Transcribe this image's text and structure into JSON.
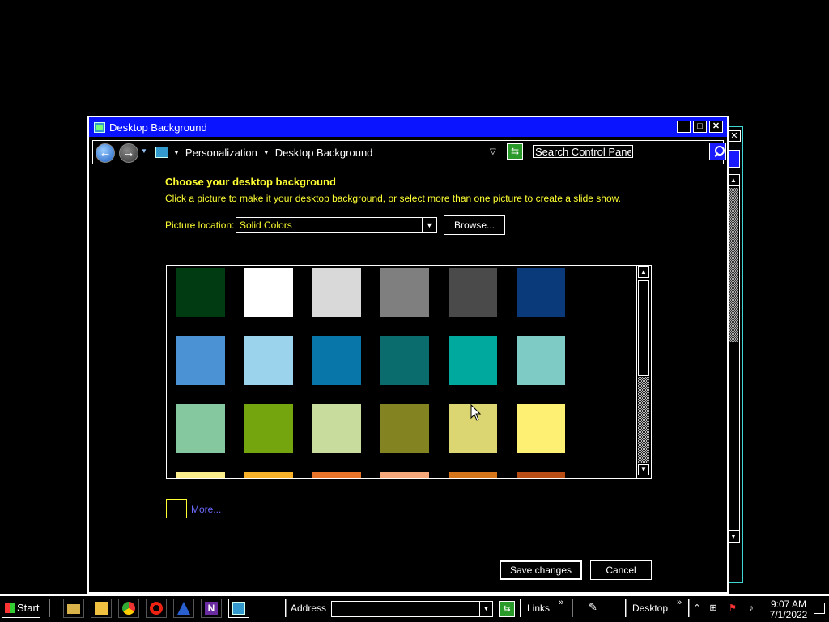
{
  "window": {
    "title": "Desktop Background",
    "buttons": [
      "_",
      "□",
      "✕"
    ]
  },
  "address_bar": {
    "crumbs": [
      "Personalization",
      "Desktop Background"
    ],
    "search_placeholder": "Search Control Panel"
  },
  "content": {
    "heading": "Choose your desktop background",
    "description": "Click a picture to make it your desktop background, or select more than one picture to create a slide show.",
    "picture_location_label": "Picture location:",
    "picture_location_value": "Solid Colors",
    "browse_label": "Browse...",
    "more_label": "More...",
    "save_label": "Save changes",
    "cancel_label": "Cancel"
  },
  "swatches": [
    [
      "#003b11",
      "#ffffff",
      "#d9d9d9",
      "#7f7f7f",
      "#4a4a4a",
      "#0b3a7b"
    ],
    [
      "#4a92d4",
      "#9cd3ec",
      "#0876a8",
      "#0b6c6e",
      "#00a99d",
      "#7ecbc6"
    ],
    [
      "#85c8a0",
      "#74a50f",
      "#c7dc9d",
      "#848321",
      "#dbd672",
      "#fef073"
    ],
    [
      "#fbec8c",
      "#f7b229",
      "#e9742a",
      "#f5a97a",
      "#d4741b",
      "#b74c14"
    ]
  ],
  "taskbar": {
    "start_label": "Start",
    "address_label": "Address",
    "links_label": "Links",
    "desktop_label": "Desktop",
    "time": "9:07 AM",
    "date": "7/1/2022"
  },
  "colors": {
    "title_bar": "#0a14ff",
    "accent_text": "#ffff33",
    "link": "#6b6bff",
    "ghost_border": "#3fd6d6"
  }
}
